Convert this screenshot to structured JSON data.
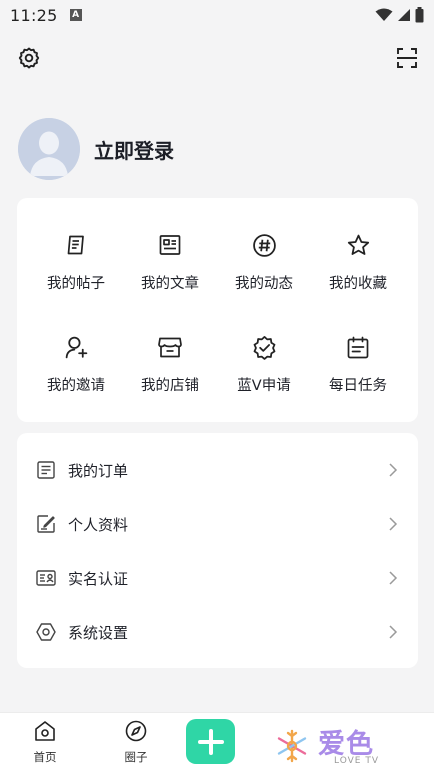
{
  "status_bar": {
    "time": "11:25",
    "notification_letter": "A"
  },
  "profile": {
    "login_label": "立即登录"
  },
  "grid": [
    {
      "label": "我的帖子",
      "icon": "posts-icon"
    },
    {
      "label": "我的文章",
      "icon": "article-icon"
    },
    {
      "label": "我的动态",
      "icon": "hashtag-icon"
    },
    {
      "label": "我的收藏",
      "icon": "star-icon"
    },
    {
      "label": "我的邀请",
      "icon": "invite-user-icon"
    },
    {
      "label": "我的店铺",
      "icon": "store-icon"
    },
    {
      "label": "蓝V申请",
      "icon": "verified-badge-icon"
    },
    {
      "label": "每日任务",
      "icon": "calendar-icon"
    }
  ],
  "list": [
    {
      "label": "我的订单",
      "icon": "order-icon"
    },
    {
      "label": "个人资料",
      "icon": "edit-profile-icon"
    },
    {
      "label": "实名认证",
      "icon": "id-card-icon"
    },
    {
      "label": "系统设置",
      "icon": "hexagon-settings-icon"
    }
  ],
  "bottom_nav": {
    "home": "首页",
    "circle": "圈子"
  },
  "watermark": {
    "text": "爱色",
    "sub": "LOVE TV"
  },
  "colors": {
    "accent": "#2fd6a6",
    "background": "#f4f4f5",
    "card": "#ffffff"
  }
}
